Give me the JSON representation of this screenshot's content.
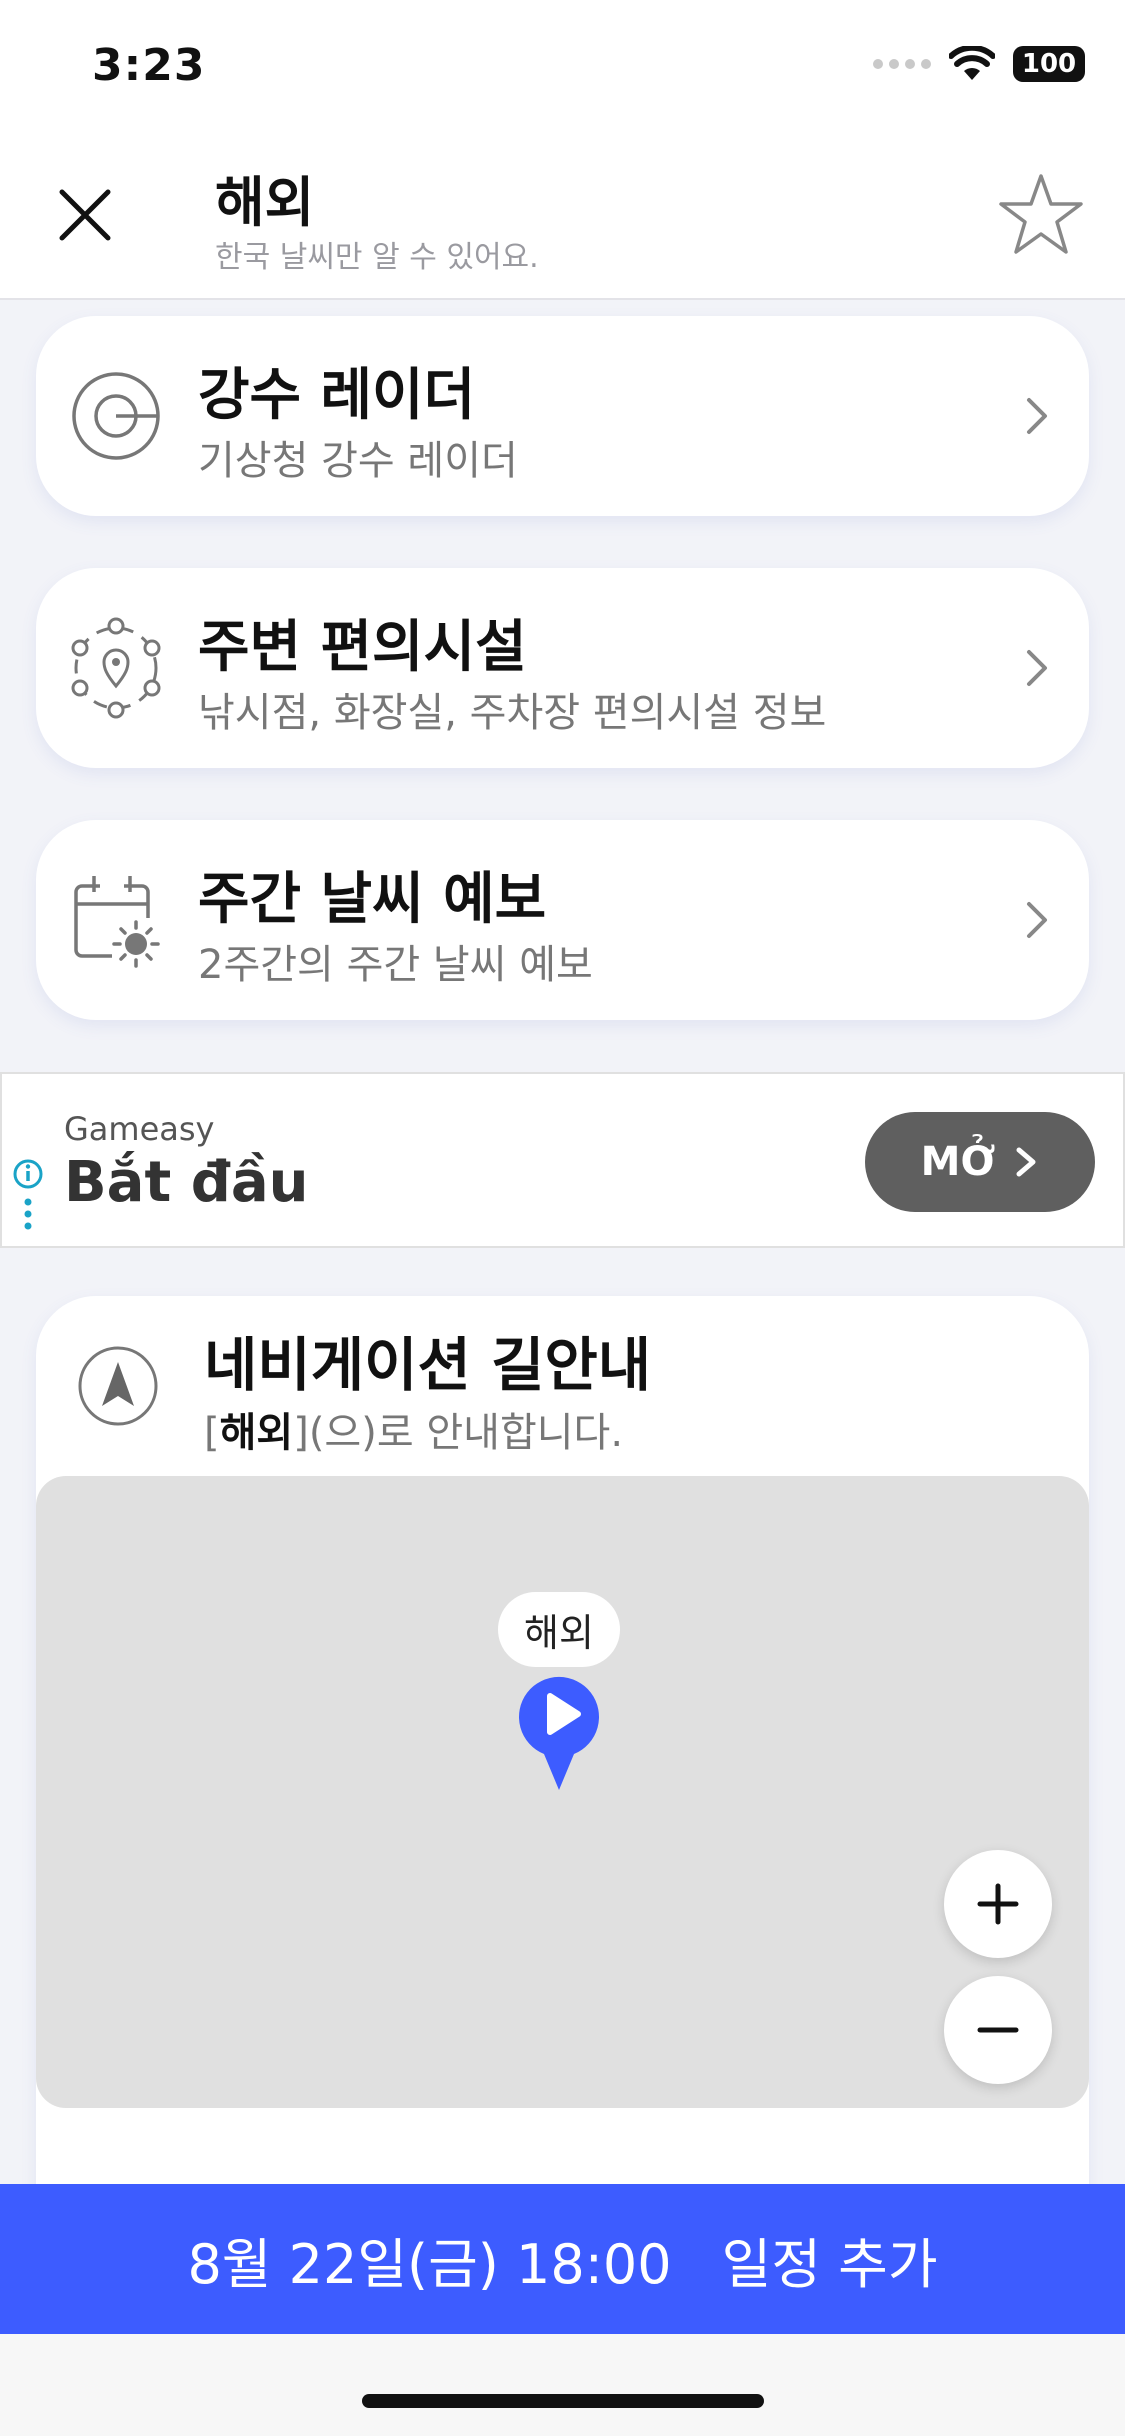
{
  "status_bar": {
    "time": "3:23",
    "battery": "100"
  },
  "header": {
    "title": "해외",
    "subtitle": "한국 날씨만 알 수 있어요."
  },
  "cards": [
    {
      "title": "강수 레이더",
      "desc": "기상청 강수 레이더",
      "icon": "radar-icon"
    },
    {
      "title": "주변 편의시설",
      "desc": "낚시점, 화장실, 주차장 편의시설 정보",
      "icon": "location-network-icon"
    },
    {
      "title": "주간 날씨 예보",
      "desc": "2주간의 주간 날씨 예보",
      "icon": "calendar-sun-icon"
    }
  ],
  "ad": {
    "advertiser": "Gameasy",
    "headline": "Bắt đầu",
    "button_label": "MỞ"
  },
  "navigation": {
    "title": "네비게이션 길안내",
    "dest_prefix": "[",
    "dest_name": "해외",
    "dest_suffix": "](으)로 안내합니다.",
    "map_label": "해외"
  },
  "bottom_bar": {
    "datetime": "8월 22일(금) 18:00",
    "action": "일정 추가"
  },
  "colors": {
    "accent": "#3d5cff",
    "ad_button": "#5f5f5f",
    "map_bg": "#e0e0e0"
  }
}
